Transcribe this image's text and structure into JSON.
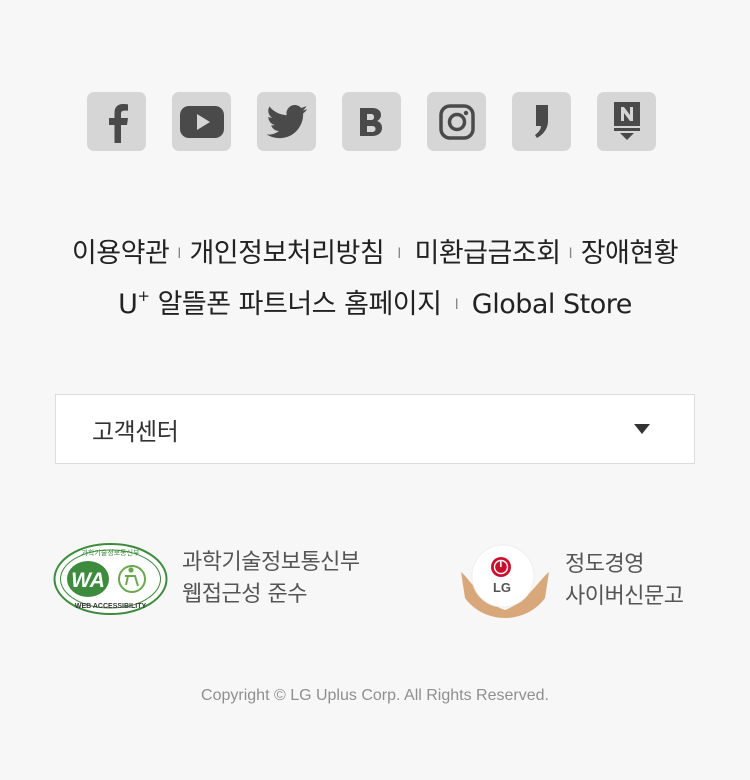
{
  "social": [
    {
      "name": "Facebook",
      "icon": "facebook-icon"
    },
    {
      "name": "YouTube",
      "icon": "youtube-icon"
    },
    {
      "name": "Twitter",
      "icon": "twitter-icon"
    },
    {
      "name": "Blog",
      "icon": "blog-icon"
    },
    {
      "name": "Instagram",
      "icon": "instagram-icon"
    },
    {
      "name": "KakaoStory",
      "icon": "kakao-icon"
    },
    {
      "name": "Naver Post",
      "icon": "naver-post-icon"
    }
  ],
  "links": {
    "terms": "이용약관",
    "privacy": "개인정보처리방침",
    "refund": "미환급금조회",
    "outage": "장애현황",
    "uplus_prefix": "U",
    "uplus_plus": "+",
    "mvno": "알뜰폰 파트너스 홈페이지",
    "global": "Global Store",
    "separator": "I"
  },
  "select": {
    "value": "고객센터"
  },
  "certs": {
    "wa": {
      "line1": "과학기술정보통신부",
      "line2": "웹접근성 준수",
      "logo_top": "과학기술정보통신부",
      "logo_main": "WA",
      "logo_bottom": "WEB ACCESSIBILITY"
    },
    "lg": {
      "line1": "정도경영",
      "line2": "사이버신문고",
      "logo_text": "LG"
    }
  },
  "copyright": "Copyright © LG Uplus Corp. All Rights Reserved.",
  "colors": {
    "background": "#f7f7f7",
    "icon_bg": "#d6d6d6",
    "icon_fg": "#4a4a4a",
    "lg_red": "#c8102e",
    "wa_green": "#2e8b3a"
  }
}
